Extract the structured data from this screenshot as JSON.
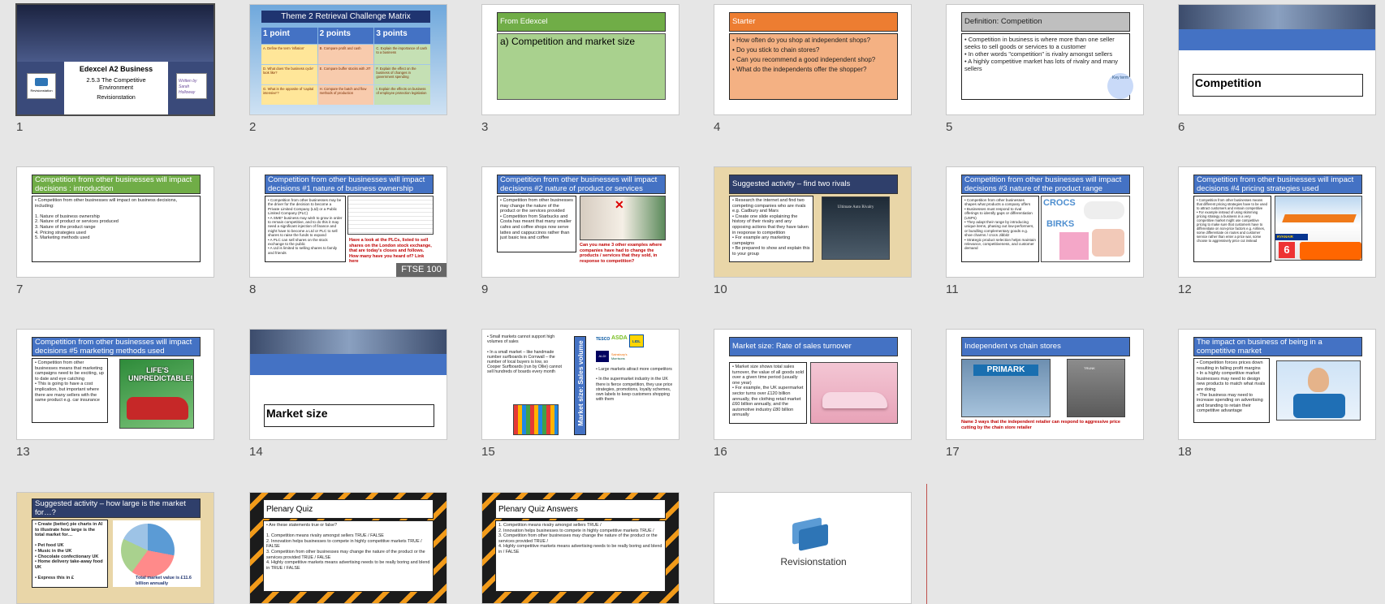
{
  "slides": [
    {
      "num": "1",
      "title": "Edexcel A2 Business",
      "subtitle": "2.5.3 The Competitive Environment",
      "footer": "Revisionstation",
      "logo": "Revisionstation",
      "signature": "Written by Sarah Holloway"
    },
    {
      "num": "2",
      "title": "Theme 2 Retrieval Challenge Matrix",
      "cols": [
        "1 point",
        "2 points",
        "3 points"
      ],
      "cells": [
        "A. Define the term 'inflation'",
        "B. Compare profit and cash",
        "C. Explain the importance of cash to a business",
        "D. What does 'the business cycle' look like?",
        "E. Compare buffer stocks with JIT",
        "F. Explain the effect on the business of changes in government spending",
        "G. What is the opposite of 'capital intensive'?",
        "H. Compare the batch and flow methods of production",
        "I. Explain the effects on business of employee protection legislation"
      ]
    },
    {
      "num": "3",
      "title": "From Edexcel",
      "body": "a) Competition and market size"
    },
    {
      "num": "4",
      "title": "Starter",
      "body": "• How often do you shop at independent shops?\n• Do you stick to chain stores?\n• Can you recommend a good independent shop?\n• What do the independents offer the shopper?"
    },
    {
      "num": "5",
      "title": "Definition: Competition",
      "body": "• Competition in business is where more than one seller seeks to sell goods or services to a customer\n• In other words \"competition\" is rivalry amongst sellers\n• A highly competitive market has lots of rivalry and many sellers",
      "badge": "Key term"
    },
    {
      "num": "6",
      "title": "Competition"
    },
    {
      "num": "7",
      "title": "Competition from other businesses will impact decisions : introduction",
      "body": "• Competition from other businesses will impact on business decisions, including:\n\n1.   Nature of business ownership\n2.   Nature of product or services produced\n3.   Nature of the product range\n4.   Pricing strategies used\n5.   Marketing methods used"
    },
    {
      "num": "8",
      "title": "Competition from other businesses will impact decisions #1 nature of business ownership",
      "body": "• Competition from other businesses may be the driver for the decision to become a Private Limited Company (Ltd) or a Public Limited Company (PLC)\n• A SME* business may wish to grow in order to remain competitive, and to do this it may need a significant injection of finance and might have to become a Ltd or PLC to sell shares to raise the funds to expand\n• A PLC can sell shares on the stock exchange to the public\n• A Ltd is limited to selling shares to family and friends",
      "note": "Have a look at the PLCs, listed to sell shares on the London stock exchange, that are today's closes and follows. How many have you heard of? Link here",
      "badge": "FTSE 100"
    },
    {
      "num": "9",
      "title": "Competition from other businesses will impact decisions #2 nature of product or services provided",
      "body": "• Competition from other businesses may change the nature of the product or the services provided\n• Competition from Starbucks and Costa has meant that many smaller cafes and coffee shops now serve lattes and cappuccinos rather than just basic tea and coffee",
      "note": "Can you name 3 other examples where companies have had to change the products / services that they sold, in response to competition?"
    },
    {
      "num": "10",
      "title": "Suggested activity – find two rivals",
      "body": "• Research the internet and find two competing companies who are rivals e.g. Cadbury and Mars\n• Create one slide explaining the history of their rivalry and any opposing actions that they have taken in response to competition\n• For example any marketing campaigns\n• Be prepared to show and explain this to your group",
      "image_caption": "Ultimate Auto Rivalry"
    },
    {
      "num": "11",
      "title": "Competition from other businesses will impact decisions #3 nature of the product range",
      "body": "• Competition from other businesses shapes what products a company offers\n• Businesses must respond to rival offerings to identify gaps or differentiation (USPs)\n• They adapt their range by introducing unique items, phasing out low-performers, or bundling complementary goods e.g. shoe charms / crocs Jibbitz\n• Strategic product selection helps maintain relevance, competitiveness, and customer demand",
      "brands": [
        "CROCS",
        "BIRKS"
      ]
    },
    {
      "num": "12",
      "title": "Competition from other businesses will impact decisions #4 pricing strategies used",
      "body": "• Competition from other businesses means that different pricing strategies have to be used to attract customers and remain competitive\n• For example instead of using skimming pricing strategy a business in a very competitive market might use competitive pricing to make sure that customers have to differentiate on non-price factors e.g. Airlines, some differentiate on routes and customer service rather than enter a price war, some choose to aggressively price cut instead",
      "brand": "RYANAIR"
    },
    {
      "num": "13",
      "title": "Competition from other businesses will impact decisions #5 marketing methods used",
      "body": "• Competition from other businesses means that marketing campaigns need to be exciting, up to date and eye catching\n• This is going to have a cost implication, but important where there are many sellers with the same product e.g. car insurance",
      "poster": "LIFE'S UNPREDICTABLE!"
    },
    {
      "num": "14",
      "title": "Market size"
    },
    {
      "num": "15",
      "left": "• Small markets cannot support high volumes of sales\n\n• In a small market – like handmade number surfboards in Cornwall – the number of local buyers is low, so Cooper Surfboards (run by Ollie) cannot sell hundreds of boards every month",
      "vertical": "Market size: Sales volume",
      "right": "• Large markets attract more competitors\n\n• In the supermarket industry in the UK there is fierce competition, they use price strategies, promotions, loyalty schemes, own labels to keep customers shopping with them",
      "brands": [
        "TESCO",
        "ASDA",
        "LIDL",
        "ALDI",
        "Sainsbury's",
        "Morrisons"
      ]
    },
    {
      "num": "16",
      "title": "Market size: Rate of sales turnover",
      "body": "• Market size shows total sales turnover, the value of all goods sold over a given time period (usually one year)\n• For example, the UK supermarket sector turns over £120 billion annually, the clothing retail market £60 billion annually, and the automotive industry £80 billion annually"
    },
    {
      "num": "17",
      "title": "Independent vs chain stores",
      "note": "Name 3 ways that the independent retailer can respond to aggressive price cutting by the chain store retailer",
      "brand": "PRIMARK",
      "shop": "TRUNK"
    },
    {
      "num": "18",
      "title": "The impact on business of being in a competitive market",
      "body": "• Competition forces prices down resulting in falling profit margins\n• In a highly competitive market businesses may need to design new products to match what rivals are doing\n• The business may need to increase spending on advertising and branding to retain their competitive advantage"
    },
    {
      "num": "19",
      "title": "Suggested activity – how large is the market for…?",
      "body": "• Create (better) pie charts in AI to illustrate how large is the total market for…\n\n• Pet food UK\n• Music in the UK\n• Chocolate confectionary UK\n• Home delivery take-away food UK\n\n• Express this in £",
      "note": "Total market value is £11.6 billion annually"
    },
    {
      "num": "20",
      "title": "Plenary Quiz",
      "body": "• Are these statements true or false?\n\n1.   Competition means rivalry amongst sellers TRUE / FALSE\n2.   Innovation helps businesses to compete in highly competitive markets TRUE / FALSE\n3.   Competition from other businesses may change the nature of the product or the services provided TRUE / FALSE\n4.   Highly competitive markets means advertising needs to be really boring and blend in TRUE / FALSE"
    },
    {
      "num": "21",
      "title": "Plenary Quiz Answers",
      "body": "1.   Competition means rivalry amongst sellers TRUE /\n2.   Innovation helps businesses to compete in highly competitive markets TRUE /\n3.   Competition from other businesses may change the nature of the product or the services provided TRUE /\n4.   Highly competitive markets means advertising needs to be really boring and blend in / FALSE"
    },
    {
      "num": "22",
      "title": "Revisionstation"
    }
  ],
  "colors": {
    "accent_blue": "#4472c4",
    "green": "#70ad47",
    "orange": "#ed7d31",
    "selection": "#4a4a4a",
    "insert_cursor": "#c0504d"
  }
}
